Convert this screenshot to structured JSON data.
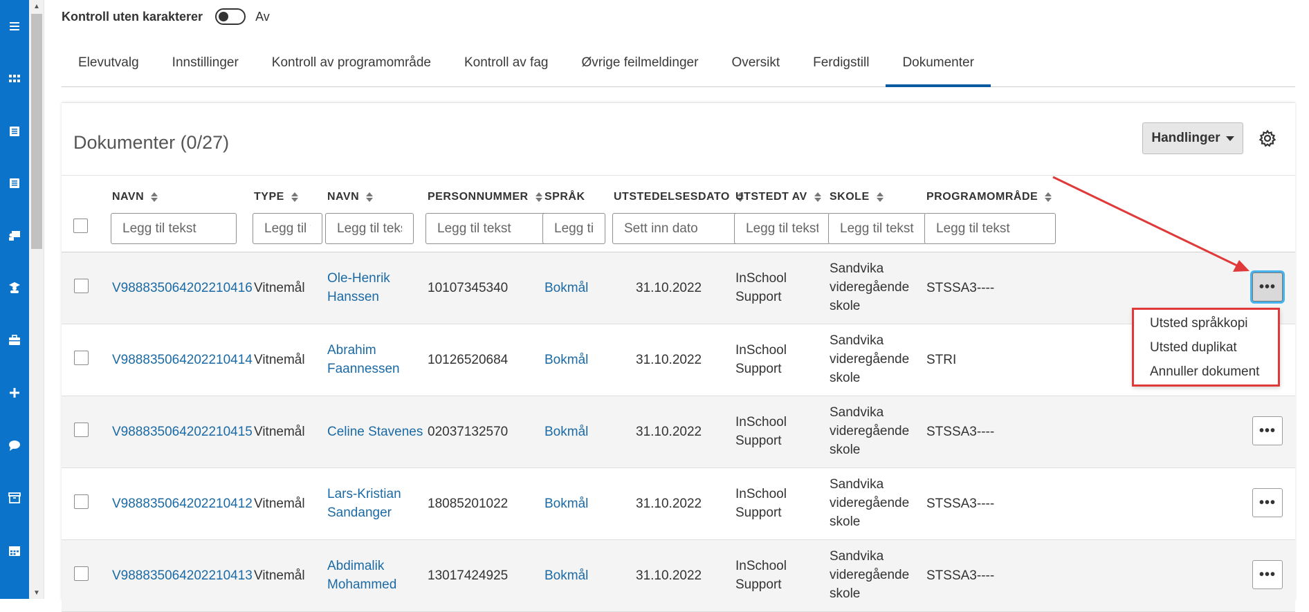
{
  "header": {
    "toggle_label": "Kontroll uten karakterer",
    "toggle_state": "Av"
  },
  "tabs": [
    {
      "label": "Elevutvalg"
    },
    {
      "label": "Innstillinger"
    },
    {
      "label": "Kontroll av programområde"
    },
    {
      "label": "Kontroll av fag"
    },
    {
      "label": "Øvrige feilmeldinger"
    },
    {
      "label": "Oversikt"
    },
    {
      "label": "Ferdigstill"
    },
    {
      "label": "Dokumenter",
      "active": true
    }
  ],
  "card": {
    "title": "Dokumenter (0/27)",
    "actions_label": "Handlinger"
  },
  "columns": [
    {
      "label": "NAVN",
      "placeholder": "Legg til tekst"
    },
    {
      "label": "TYPE",
      "placeholder": "Legg til tekst"
    },
    {
      "label": "NAVN",
      "placeholder": "Legg til tekst"
    },
    {
      "label": "PERSONNUMMER",
      "placeholder": "Legg til tekst"
    },
    {
      "label": "SPRÅK",
      "placeholder": "Legg til tekst"
    },
    {
      "label": "UTSTEDELSESDATO",
      "placeholder": "Sett inn dato"
    },
    {
      "label": "UTSTEDT AV",
      "placeholder": "Legg til tekst"
    },
    {
      "label": "SKOLE",
      "placeholder": "Legg til tekst"
    },
    {
      "label": "PROGRAMOMRÅDE",
      "placeholder": "Legg til tekst"
    }
  ],
  "rows": [
    {
      "doc": "V988835064202210416",
      "type": "Vitnemål",
      "name1": "Ole-Henrik",
      "name2": "Hanssen",
      "pnr": "10107345340",
      "lang": "Bokmål",
      "date": "31.10.2022",
      "by1": "InSchool",
      "by2": "Support",
      "school1": "Sandvika",
      "school2": "videregående",
      "school3": "skole",
      "program": "STSSA3----"
    },
    {
      "doc": "V988835064202210414",
      "type": "Vitnemål",
      "name1": "Abrahim",
      "name2": "Faannessen",
      "pnr": "10126520684",
      "lang": "Bokmål",
      "date": "31.10.2022",
      "by1": "InSchool",
      "by2": "Support",
      "school1": "Sandvika",
      "school2": "videregående",
      "school3": "skole",
      "program": "STRI"
    },
    {
      "doc": "V988835064202210415",
      "type": "Vitnemål",
      "name1": "Celine Stavenes",
      "name2": "",
      "pnr": "02037132570",
      "lang": "Bokmål",
      "date": "31.10.2022",
      "by1": "InSchool",
      "by2": "Support",
      "school1": "Sandvika",
      "school2": "videregående",
      "school3": "skole",
      "program": "STSSA3----"
    },
    {
      "doc": "V988835064202210412",
      "type": "Vitnemål",
      "name1": "Lars-Kristian",
      "name2": "Sandanger",
      "pnr": "18085201022",
      "lang": "Bokmål",
      "date": "31.10.2022",
      "by1": "InSchool",
      "by2": "Support",
      "school1": "Sandvika",
      "school2": "videregående",
      "school3": "skole",
      "program": "STSSA3----"
    },
    {
      "doc": "V988835064202210413",
      "type": "Vitnemål",
      "name1": "Abdimalik",
      "name2": "Mohammed",
      "pnr": "13017424925",
      "lang": "Bokmål",
      "date": "31.10.2022",
      "by1": "InSchool",
      "by2": "Support",
      "school1": "Sandvika",
      "school2": "videregående",
      "school3": "skole",
      "program": "STSSA3----"
    }
  ],
  "row_menu": {
    "more_label": "•••",
    "items": [
      "Utsted språkkopi",
      "Utsted duplikat",
      "Annuller dokument"
    ]
  },
  "colors": {
    "rail": "#0b73c9",
    "link": "#1b6aa5",
    "active_tab": "#0b5aa2",
    "annotation": "#e0393a",
    "focus": "#47b3ee"
  },
  "rail_icons": [
    "menu-icon",
    "grid-icon",
    "book-icon",
    "book-icon",
    "teacher-icon",
    "student-icon",
    "briefcase-icon",
    "plus-icon",
    "chat-icon",
    "archive-icon",
    "calendar-icon"
  ]
}
